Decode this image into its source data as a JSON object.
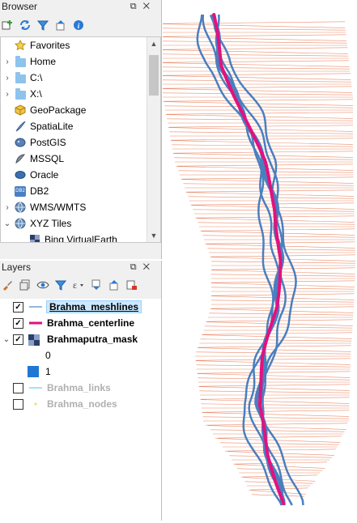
{
  "browser": {
    "title": "Browser",
    "items": [
      {
        "label": "Favorites",
        "icon": "star-icon"
      },
      {
        "label": "Home",
        "icon": "folder-icon"
      },
      {
        "label": "C:\\",
        "icon": "folder-icon"
      },
      {
        "label": "X:\\",
        "icon": "folder-icon"
      },
      {
        "label": "GeoPackage",
        "icon": "geopackage-icon"
      },
      {
        "label": "SpatiaLite",
        "icon": "spatialite-icon"
      },
      {
        "label": "PostGIS",
        "icon": "postgis-icon"
      },
      {
        "label": "MSSQL",
        "icon": "mssql-icon"
      },
      {
        "label": "Oracle",
        "icon": "oracle-icon"
      },
      {
        "label": "DB2",
        "icon": "db2-icon",
        "badge": "DB2"
      },
      {
        "label": "WMS/WMTS",
        "icon": "globe-icon"
      },
      {
        "label": "XYZ Tiles",
        "icon": "globe-icon"
      },
      {
        "label": "Bing VirtualEarth",
        "icon": "tiles-icon"
      }
    ]
  },
  "layers": {
    "title": "Layers",
    "items": [
      {
        "label": "Brahma_meshlines",
        "checked": true,
        "selected": true,
        "symbol": "line",
        "color": "#6d9fd6"
      },
      {
        "label": "Brahma_centerline",
        "checked": true,
        "symbol": "line",
        "color": "#e3117e"
      },
      {
        "label": "Brahmaputra_mask",
        "checked": true,
        "symbol": "raster"
      },
      {
        "label": "Brahma_links",
        "checked": false,
        "dim": true,
        "symbol": "line",
        "color": "#7fd8ff"
      },
      {
        "label": "Brahma_nodes",
        "checked": false,
        "dim": true,
        "symbol": "point",
        "color": "#f0e060"
      }
    ],
    "mask_legend": [
      {
        "label": "0",
        "color": "#ffffff"
      },
      {
        "label": "1",
        "color": "#1f77d4"
      }
    ]
  },
  "colors": {
    "meshlines": "#e8774f",
    "river": "#4a7fbf",
    "centerline": "#e3117e"
  }
}
